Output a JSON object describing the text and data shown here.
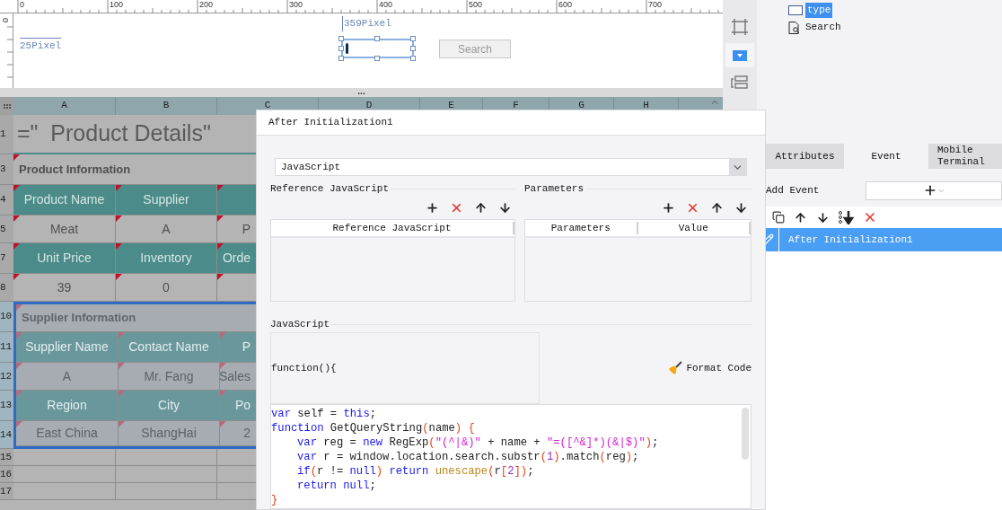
{
  "ruler": {
    "labels": [
      "0",
      "100",
      "200",
      "300",
      "400",
      "500",
      "600",
      "700"
    ],
    "side_label": "0"
  },
  "canvas": {
    "guides": [
      {
        "kind": "left",
        "text": "25Pixel"
      },
      {
        "kind": "top",
        "text": "359Pixel"
      }
    ],
    "search_button": "Search"
  },
  "splitter": "...",
  "sheet": {
    "columns": [
      "A",
      "B",
      "C",
      "D",
      "E",
      "F",
      "G",
      "H"
    ],
    "rows": [
      {
        "number": "1",
        "kind": "title",
        "selected": false,
        "cells": [
          "=\"  Product Details\""
        ]
      },
      {
        "number": "3",
        "kind": "section",
        "selected": false,
        "cells": [
          "Product Information"
        ]
      },
      {
        "number": "4",
        "kind": "header",
        "selected": false,
        "cells": [
          "Product Name",
          "Supplier"
        ]
      },
      {
        "number": "5",
        "kind": "data",
        "selected": false,
        "cells": [
          "Meat",
          "A",
          "P"
        ]
      },
      {
        "number": "7",
        "kind": "header",
        "selected": false,
        "cells": [
          "Unit Price",
          "Inventory",
          "Orde"
        ]
      },
      {
        "number": "8",
        "kind": "data",
        "selected": false,
        "cells": [
          "39",
          "0"
        ]
      },
      {
        "number": "10",
        "kind": "section",
        "selected": true,
        "cells": [
          "Supplier Information"
        ]
      },
      {
        "number": "11",
        "kind": "header",
        "selected": true,
        "cells": [
          "Supplier Name",
          "Contact Name",
          "P"
        ]
      },
      {
        "number": "12",
        "kind": "data",
        "selected": true,
        "cells": [
          "A",
          "Mr. Fang",
          "Sales"
        ]
      },
      {
        "number": "13",
        "kind": "header",
        "selected": true,
        "cells": [
          "Region",
          "City",
          "Po"
        ]
      },
      {
        "number": "14",
        "kind": "data",
        "selected": true,
        "cells": [
          "East China",
          "ShangHai",
          "2"
        ]
      },
      {
        "number": "15",
        "kind": "empty",
        "selected": false,
        "cells": []
      },
      {
        "number": "16",
        "kind": "empty",
        "selected": false,
        "cells": []
      },
      {
        "number": "17",
        "kind": "empty",
        "selected": false,
        "cells": []
      }
    ]
  },
  "outline": [
    {
      "label": "type",
      "kind": "textbox",
      "selected": true
    },
    {
      "label": "Search",
      "kind": "button",
      "selected": false
    }
  ],
  "panel": {
    "tabs": [
      {
        "label": "Attributes",
        "selected": false
      },
      {
        "label": "Event",
        "selected": true
      },
      {
        "label": "Mobile Terminal",
        "selected": false
      }
    ],
    "add_event": "Add Event",
    "events": [
      {
        "label": "After Initialization1",
        "selected": true
      }
    ]
  },
  "dialog": {
    "title": "After Initialization1",
    "language": "JavaScript",
    "reference": {
      "title": "Reference JavaScript",
      "columns": [
        "Reference JavaScript"
      ]
    },
    "parameters": {
      "title": "Parameters",
      "columns": [
        "Parameters",
        "Value"
      ]
    },
    "script_label": "JavaScript",
    "function_header": "function(){",
    "format_button": "Format Code",
    "code": [
      {
        "indented": false,
        "tokens": [
          {
            "kind": "keyword",
            "text": "var"
          },
          {
            "kind": "plain",
            "text": " self = "
          },
          {
            "kind": "keyword",
            "text": "this"
          },
          {
            "kind": "plain",
            "text": ";"
          }
        ]
      },
      {
        "indented": false,
        "tokens": [
          {
            "kind": "keyword",
            "text": "function"
          },
          {
            "kind": "plain",
            "text": " GetQueryString"
          },
          {
            "kind": "bracket",
            "text": "("
          },
          {
            "kind": "plain",
            "text": "name"
          },
          {
            "kind": "bracket",
            "text": ")"
          },
          {
            "kind": "bracket",
            "text": " {"
          }
        ]
      },
      {
        "indented": true,
        "tokens": [
          {
            "kind": "keyword",
            "text": "var"
          },
          {
            "kind": "plain",
            "text": " reg = "
          },
          {
            "kind": "keyword",
            "text": "new"
          },
          {
            "kind": "plain",
            "text": " RegExp"
          },
          {
            "kind": "bracket",
            "text": "("
          },
          {
            "kind": "string",
            "text": "\"(^|&)\""
          },
          {
            "kind": "plain",
            "text": " + name + "
          },
          {
            "kind": "string",
            "text": "\"=([^&]*)(&|$)\""
          },
          {
            "kind": "bracket",
            "text": ")"
          },
          {
            "kind": "plain",
            "text": ";"
          }
        ]
      },
      {
        "indented": true,
        "tokens": [
          {
            "kind": "keyword",
            "text": "var"
          },
          {
            "kind": "plain",
            "text": " r = window.location.search.substr"
          },
          {
            "kind": "bracket",
            "text": "("
          },
          {
            "kind": "number",
            "text": "1"
          },
          {
            "kind": "bracket",
            "text": ")"
          },
          {
            "kind": "plain",
            "text": ".match"
          },
          {
            "kind": "bracket",
            "text": "("
          },
          {
            "kind": "plain",
            "text": "reg"
          },
          {
            "kind": "bracket",
            "text": ")"
          },
          {
            "kind": "plain",
            "text": ";"
          }
        ]
      },
      {
        "indented": true,
        "tokens": [
          {
            "kind": "keyword",
            "text": "if"
          },
          {
            "kind": "bracket",
            "text": "("
          },
          {
            "kind": "plain",
            "text": "r != "
          },
          {
            "kind": "keyword",
            "text": "null"
          },
          {
            "kind": "bracket",
            "text": ")"
          },
          {
            "kind": "keyword",
            "text": " return"
          },
          {
            "kind": "builtin",
            "text": " unescape"
          },
          {
            "kind": "bracket",
            "text": "("
          },
          {
            "kind": "plain",
            "text": "r"
          },
          {
            "kind": "bracket",
            "text": "["
          },
          {
            "kind": "number",
            "text": "2"
          },
          {
            "kind": "bracket",
            "text": "]"
          },
          {
            "kind": "bracket",
            "text": ")"
          },
          {
            "kind": "plain",
            "text": ";"
          }
        ]
      },
      {
        "indented": true,
        "tokens": [
          {
            "kind": "keyword",
            "text": "return"
          },
          {
            "kind": "keyword",
            "text": " null"
          },
          {
            "kind": "plain",
            "text": ";"
          }
        ]
      },
      {
        "indented": false,
        "tokens": [
          {
            "kind": "bracket",
            "text": "}"
          }
        ]
      }
    ]
  }
}
